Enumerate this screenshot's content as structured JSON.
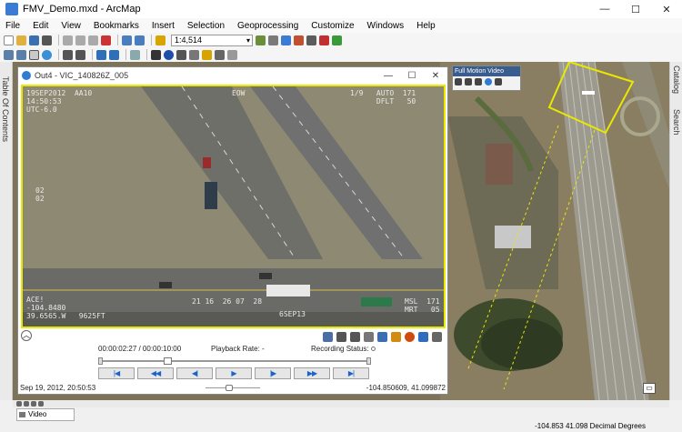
{
  "window": {
    "title": "FMV_Demo.mxd - ArcMap",
    "minimize": "—",
    "maximize": "☐",
    "close": "✕"
  },
  "menu": [
    "File",
    "Edit",
    "View",
    "Bookmarks",
    "Insert",
    "Selection",
    "Geoprocessing",
    "Customize",
    "Windows",
    "Help"
  ],
  "toolbar": {
    "scale": "1:4,514"
  },
  "left_dock": {
    "label": "Table Of Contents"
  },
  "right_dock": {
    "catalog": "Catalog",
    "search": "Search"
  },
  "fmv_window": {
    "title": "Out4 - VIC_140826Z_005",
    "hud": {
      "top_left": "19SEP2012  AA10\n14:50:53\nUTC-6.0",
      "top_center": "EOW",
      "top_right": "1/9   AUTO  171\n      DFLT   50",
      "left_mid": "02\n02",
      "bottom_left": "ACE!\n-104.8480\n39.6565.W   9625FT",
      "bottom_center": "21 16  26 07  28",
      "bottom_right": "MSL  171\nMRT   05",
      "bottom_mid": "6SEP13"
    },
    "time": "00:00:02:27 / 00:00:10:00",
    "playback_rate_label": "Playback Rate: -",
    "recording_status_label": "Recording Status:",
    "controls": [
      "|◀",
      "◀◀",
      "◀|",
      "▶",
      "|▶",
      "▶▶",
      "▶|"
    ],
    "timestamp": "Sep 19, 2012, 20:50:53",
    "coords": "-104.850609, 41.099872"
  },
  "fmv_panel": {
    "title": "Full Motion Video"
  },
  "video_manager": {
    "label": "Video Manager"
  },
  "status": {
    "coordinates": "-104.853  41.098 Decimal Degrees"
  },
  "colors": {
    "footprint": "#e8e800",
    "control_icon": "#1b63c9"
  }
}
